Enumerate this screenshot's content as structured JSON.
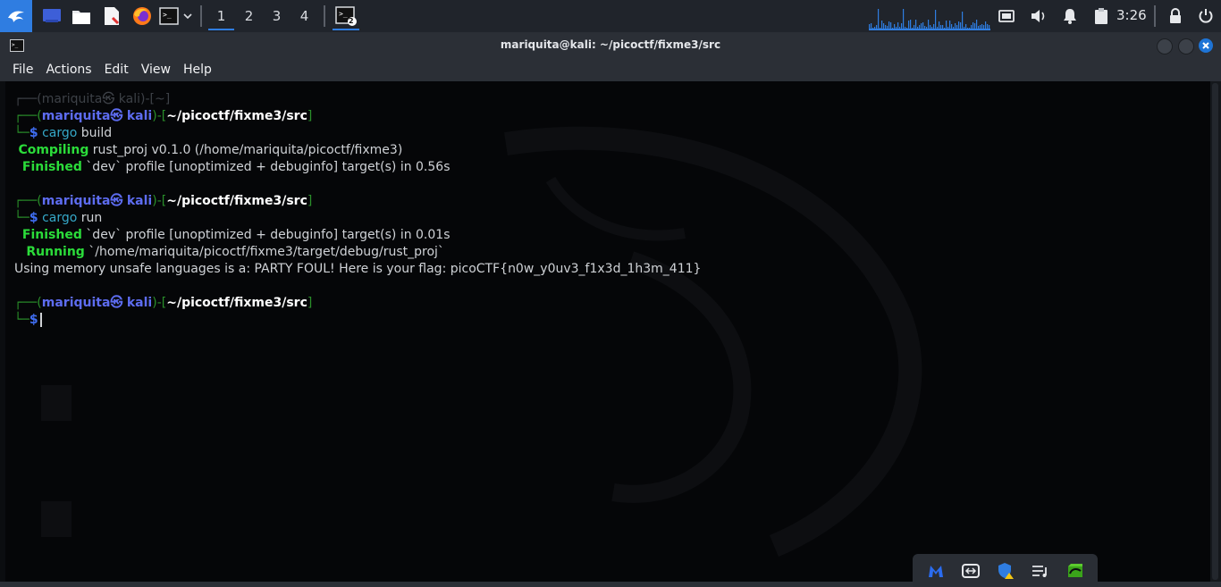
{
  "panel": {
    "workspaces": [
      "1",
      "2",
      "3",
      "4"
    ],
    "active_workspace": "1",
    "clock": "3:26",
    "task_badge": "2"
  },
  "window": {
    "title": "mariquita@kali: ~/picoctf/fixme3/src"
  },
  "menu": {
    "items": [
      "File",
      "Actions",
      "Edit",
      "View",
      "Help"
    ]
  },
  "terminal": {
    "ghost_prompt": {
      "open": "┌──(",
      "user": "mariquita㉿",
      "host": "kali",
      "mid": ")-[",
      "path": "~",
      "close": "]"
    },
    "prompt": {
      "open": "┌──(",
      "user": "mariquita㉿",
      "host": "kali",
      "mid": ")-[",
      "path": "~/picoctf/fixme3/src",
      "close": "]",
      "corner": "└─",
      "dollar": "$"
    },
    "commands": [
      {
        "cmd": "cargo",
        "arg": " build"
      },
      {
        "cmd": "cargo",
        "arg": " run"
      }
    ],
    "output": {
      "compiling_label": "Compiling",
      "compiling_text": " rust_proj v0.1.0 (/home/mariquita/picoctf/fixme3)",
      "finished_label": "Finished",
      "finished_text_1": " `dev` profile [unoptimized + debuginfo] target(s) in 0.56s",
      "finished_text_2": " `dev` profile [unoptimized + debuginfo] target(s) in 0.01s",
      "running_label": "Running",
      "running_text": " `/home/mariquita/picoctf/fixme3/target/debug/rust_proj`",
      "flag_line": "Using memory unsafe languages is a: PARTY FOUL! Here is your flag: picoCTF{n0w_y0uv3_f1x3d_1h3m_411}"
    }
  },
  "colors": {
    "accent": "#2f7de1",
    "prompt_user": "#5d6cf0",
    "prompt_box": "#2a8f2a",
    "cargo_status": "#2bdc3a",
    "close_button": "#1e74d6"
  },
  "icons": {
    "kali": "kali-menu-icon",
    "desktop": "show-desktop-icon",
    "files": "file-manager-icon",
    "editor": "text-editor-icon",
    "browser": "firefox-icon",
    "terminal": "terminal-icon",
    "tray": [
      "screen-icon",
      "volume-icon",
      "bell-icon",
      "clipboard-icon",
      "lock-icon",
      "power-icon"
    ],
    "tray2": [
      "malwarebytes-icon",
      "teamviewer-icon",
      "defender-icon",
      "playlist-icon",
      "nvidia-icon"
    ]
  }
}
